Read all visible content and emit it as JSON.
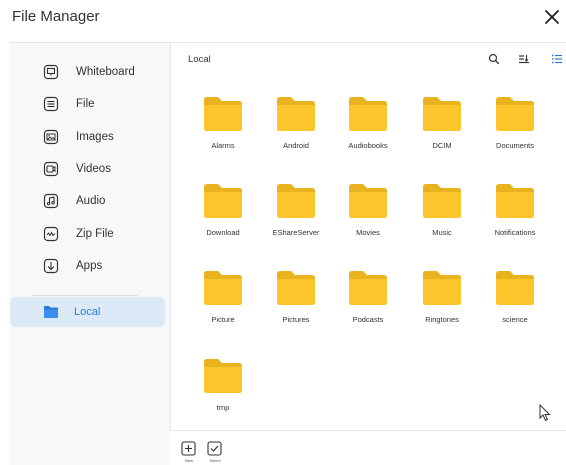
{
  "app": {
    "title": "File Manager"
  },
  "sidebar": {
    "items": [
      {
        "label": "Whiteboard",
        "icon": "whiteboard-icon"
      },
      {
        "label": "File",
        "icon": "file-icon"
      },
      {
        "label": "Images",
        "icon": "image-icon"
      },
      {
        "label": "Videos",
        "icon": "video-icon"
      },
      {
        "label": "Audio",
        "icon": "audio-icon"
      },
      {
        "label": "Zip File",
        "icon": "zip-icon"
      },
      {
        "label": "Apps",
        "icon": "download-icon"
      }
    ],
    "local": {
      "label": "Local",
      "icon": "folder-icon",
      "selected": true
    }
  },
  "main": {
    "path": "Local",
    "folders": [
      "Alarms",
      "Android",
      "Audiobooks",
      "DCIM",
      "Documents",
      "Download",
      "EShareServer",
      "Movies",
      "Music",
      "Notifications",
      "Picture",
      "Pictures",
      "Podcasts",
      "Ringtones",
      "science",
      "tmp"
    ]
  },
  "toolbar": {
    "new_label": "New",
    "select_label": "Select"
  },
  "colors": {
    "folder": "#fcc52b",
    "accent": "#2d7ad6",
    "selected_bg": "#dce9f7",
    "sidebar_bg": "#f7f8fa"
  }
}
